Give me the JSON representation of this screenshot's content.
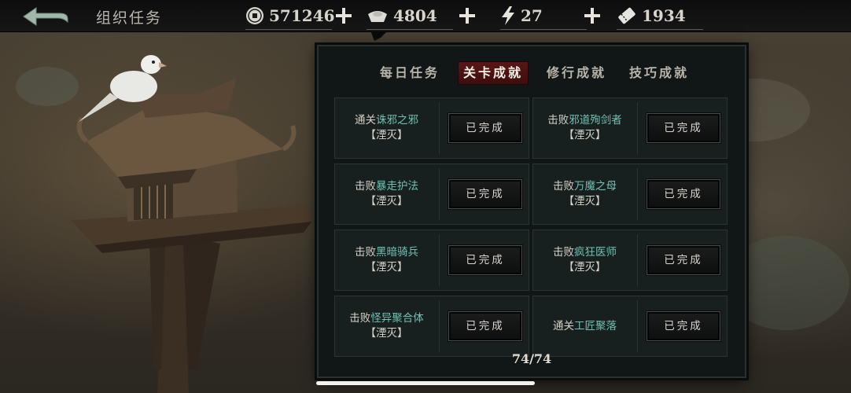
{
  "header": {
    "title": "组织任务",
    "resources": [
      {
        "icon": "coin-icon",
        "value": "571246"
      },
      {
        "icon": "silver-ingot-icon",
        "value": "4804"
      },
      {
        "icon": "lightning-icon",
        "value": "27"
      },
      {
        "icon": "ticket-icon",
        "value": "1934"
      }
    ]
  },
  "tabs": [
    {
      "label": "每日任务",
      "active": false
    },
    {
      "label": "关卡成就",
      "active": true
    },
    {
      "label": "修行成就",
      "active": false
    },
    {
      "label": "技巧成就",
      "active": false
    }
  ],
  "achievements": [
    {
      "prefix": "通关",
      "target": "诛邪之邪",
      "suffix": "【湮灭】",
      "status": "已完成"
    },
    {
      "prefix": "击败",
      "target": "邪道殉剑者",
      "suffix": "【湮灭】",
      "status": "已完成"
    },
    {
      "prefix": "击败",
      "target": "暴走护法",
      "suffix": "【湮灭】",
      "status": "已完成"
    },
    {
      "prefix": "击败",
      "target": "万魔之母",
      "suffix": "【湮灭】",
      "status": "已完成"
    },
    {
      "prefix": "击败",
      "target": "黑暗骑兵",
      "suffix": "【湮灭】",
      "status": "已完成"
    },
    {
      "prefix": "击败",
      "target": "疯狂医师",
      "suffix": "【湮灭】",
      "status": "已完成"
    },
    {
      "prefix": "击败",
      "target": "怪异聚合体",
      "suffix": "【湮灭】",
      "status": "已完成"
    },
    {
      "prefix": "通关",
      "target": "工匠聚落",
      "suffix": "",
      "status": "已完成"
    }
  ],
  "progress": "74/74",
  "colors": {
    "highlight": "#6fc0b3",
    "active_tab": "#5a1616",
    "panel_bg": "#101716"
  }
}
